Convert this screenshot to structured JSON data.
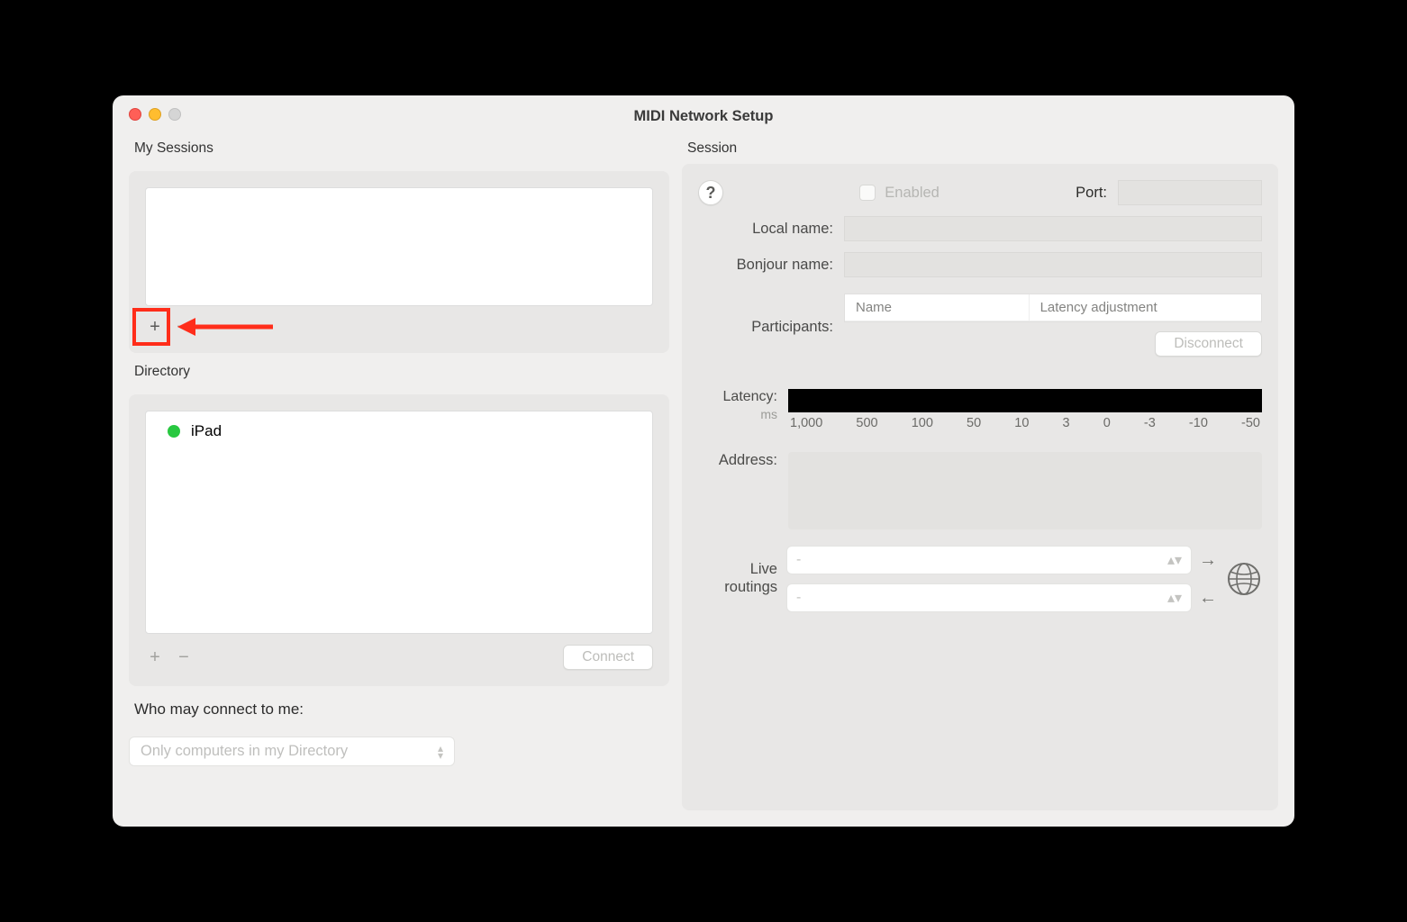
{
  "window": {
    "title": "MIDI Network Setup"
  },
  "left": {
    "sessions_header": "My Sessions",
    "directory_header": "Directory",
    "directory_items": [
      {
        "name": "iPad",
        "online": true
      }
    ],
    "connect_label": "Connect",
    "who_label": "Who may connect to me:",
    "who_value": "Only computers in my Directory"
  },
  "right": {
    "header": "Session",
    "enabled_label": "Enabled",
    "port_label": "Port:",
    "port_value": "",
    "local_name_label": "Local name:",
    "local_name_value": "",
    "bonjour_label": "Bonjour name:",
    "bonjour_value": "",
    "participants_label": "Participants:",
    "participants_col1": "Name",
    "participants_col2": "Latency adjustment",
    "disconnect_label": "Disconnect",
    "latency_label": "Latency:",
    "latency_unit": "ms",
    "latency_ticks": [
      "1,000",
      "500",
      "100",
      "50",
      "10",
      "3",
      "0",
      "-3",
      "-10",
      "-50"
    ],
    "address_label": "Address:",
    "routings_label_line1": "Live",
    "routings_label_line2": "routings",
    "routing_value": "-"
  }
}
